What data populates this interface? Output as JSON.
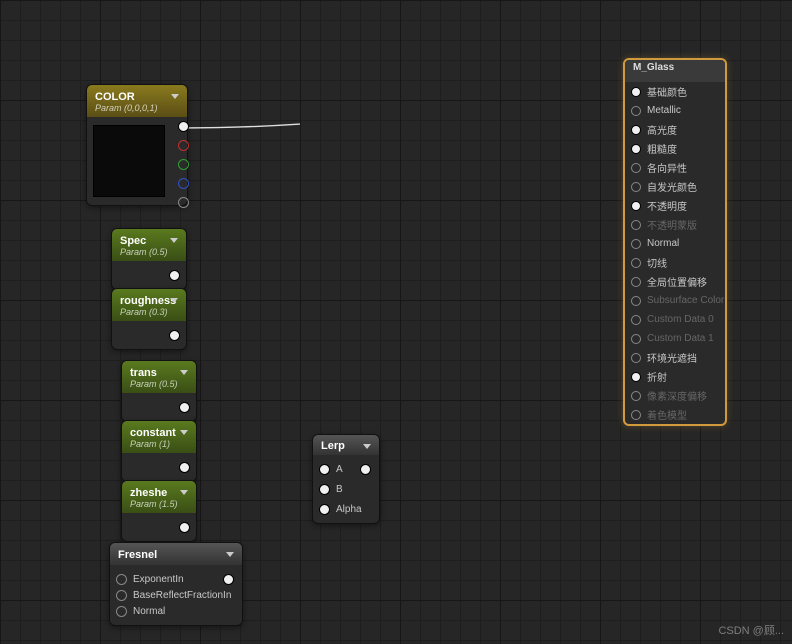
{
  "watermark": "CSDN @顾...",
  "nodes": {
    "color": {
      "title": "COLOR",
      "sub": "Param (0,0,0,1)"
    },
    "spec": {
      "title": "Spec",
      "sub": "Param (0.5)"
    },
    "roughness": {
      "title": "roughness",
      "sub": "Param (0.3)"
    },
    "trans": {
      "title": "trans",
      "sub": "Param (0.5)"
    },
    "constant": {
      "title": "constant",
      "sub": "Param (1)"
    },
    "zheshe": {
      "title": "zheshe",
      "sub": "Param (1.5)"
    },
    "fresnel": {
      "title": "Fresnel",
      "pins": [
        "ExponentIn",
        "BaseReflectFractionIn",
        "Normal"
      ]
    },
    "lerp": {
      "title": "Lerp",
      "pins": [
        "A",
        "B",
        "Alpha"
      ]
    }
  },
  "material": {
    "title": "M_Glass",
    "inputs": [
      {
        "label": "基础颜色",
        "active": true
      },
      {
        "label": "Metallic",
        "active": false
      },
      {
        "label": "高光度",
        "active": true
      },
      {
        "label": "粗糙度",
        "active": true
      },
      {
        "label": "各向异性",
        "active": false
      },
      {
        "label": "自发光颜色",
        "active": false
      },
      {
        "label": "不透明度",
        "active": true
      },
      {
        "label": "不透明蒙版",
        "active": false,
        "dim": true
      },
      {
        "label": "Normal",
        "active": false
      },
      {
        "label": "切线",
        "active": false
      },
      {
        "label": "全局位置偏移",
        "active": false
      },
      {
        "label": "Subsurface Color",
        "active": false,
        "dim": true
      },
      {
        "label": "Custom Data 0",
        "active": false,
        "dim": true
      },
      {
        "label": "Custom Data 1",
        "active": false,
        "dim": true
      },
      {
        "label": "环境光遮挡",
        "active": false
      },
      {
        "label": "折射",
        "active": true
      },
      {
        "label": "像素深度偏移",
        "active": false,
        "dim": true
      },
      {
        "label": "着色模型",
        "active": false,
        "dim": true
      }
    ]
  }
}
